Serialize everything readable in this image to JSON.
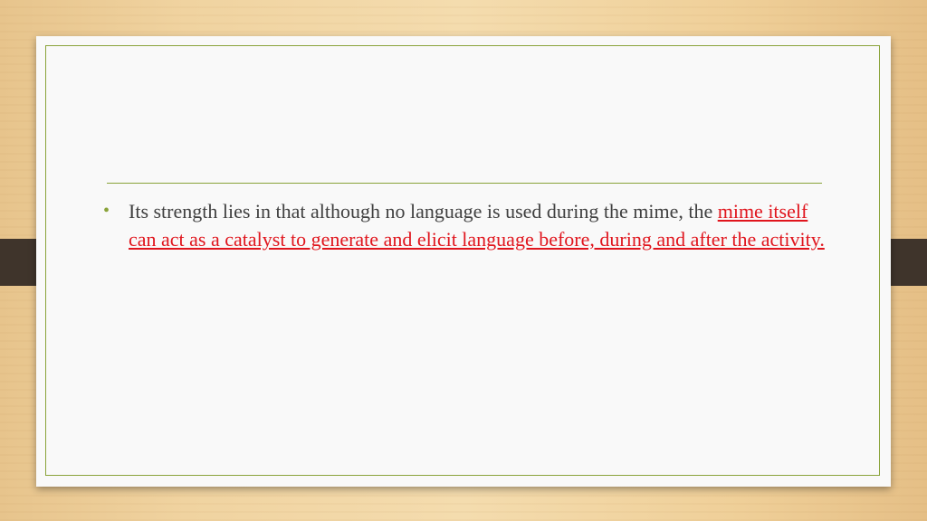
{
  "slide": {
    "bullets": [
      {
        "plain": "Its strength lies in  that although no language is used during the mime, the ",
        "emphasis": "mime itself  can act as a catalyst to generate and elicit language before, during and after the activity."
      }
    ]
  },
  "colors": {
    "accent_green": "#8aa33a",
    "emphasis_red": "#e0151d",
    "body_text": "#404040",
    "tab_dark": "#3f342b"
  }
}
